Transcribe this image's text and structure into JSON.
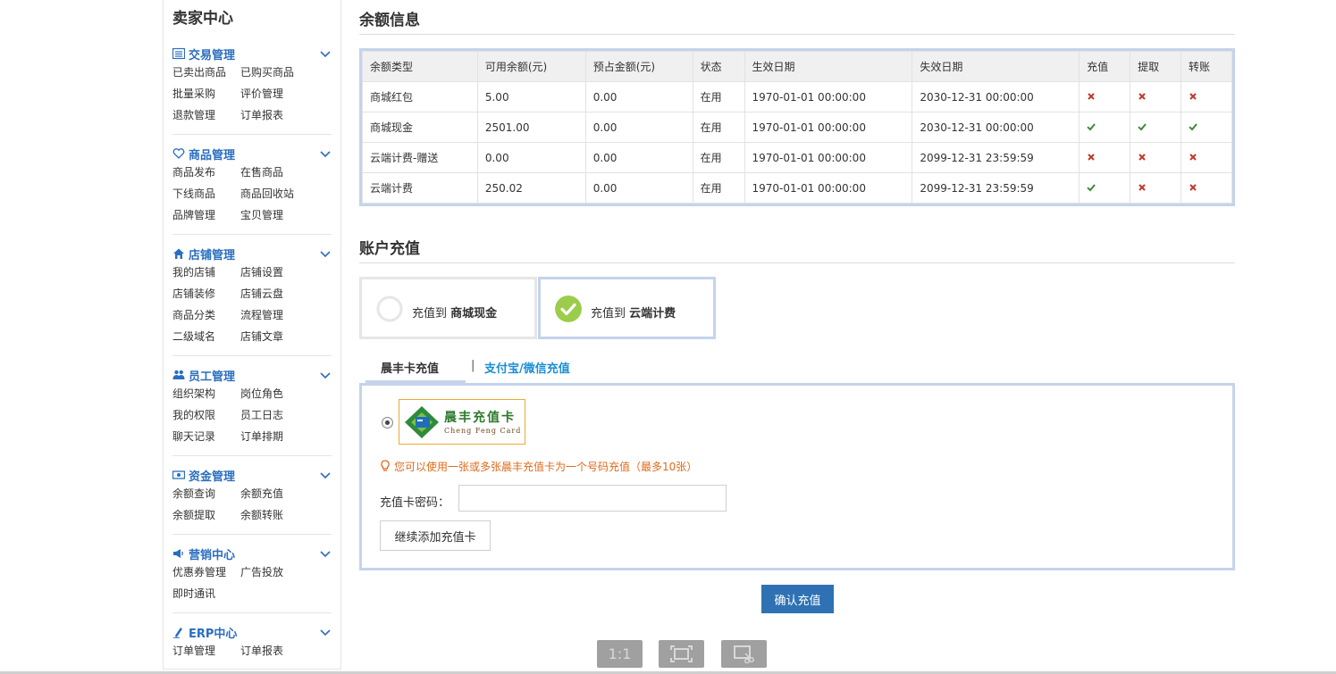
{
  "sidebar": {
    "title": "卖家中心",
    "groups": [
      {
        "title": "交易管理",
        "icon": "list-icon",
        "links": [
          "已卖出商品",
          "已购买商品",
          "批量采购",
          "评价管理",
          "退款管理",
          "订单报表"
        ]
      },
      {
        "title": "商品管理",
        "icon": "heart-icon",
        "links": [
          "商品发布",
          "在售商品",
          "下线商品",
          "商品回收站",
          "品牌管理",
          "宝贝管理"
        ]
      },
      {
        "title": "店铺管理",
        "icon": "home-icon",
        "links": [
          "我的店铺",
          "店铺设置",
          "店铺装修",
          "店铺云盘",
          "商品分类",
          "流程管理",
          "二级域名",
          "店铺文章"
        ]
      },
      {
        "title": "员工管理",
        "icon": "users-icon",
        "links": [
          "组织架构",
          "岗位角色",
          "我的权限",
          "员工日志",
          "聊天记录",
          "订单排期"
        ]
      },
      {
        "title": "资金管理",
        "icon": "money-icon",
        "links": [
          "余额查询",
          "余额充值",
          "余额提取",
          "余额转账"
        ]
      },
      {
        "title": "营销中心",
        "icon": "megaphone-icon",
        "links": [
          "优惠券管理",
          "广告投放",
          "即时通讯"
        ]
      },
      {
        "title": "ERP中心",
        "icon": "pen-icon",
        "links": [
          "订单管理",
          "订单报表"
        ]
      }
    ]
  },
  "balance": {
    "title": "余额信息",
    "columns": [
      "余额类型",
      "可用余额(元)",
      "预占金额(元)",
      "状态",
      "生效日期",
      "失效日期",
      "充值",
      "提取",
      "转账"
    ],
    "rows": [
      {
        "type": "商城红包",
        "available": "5.00",
        "reserved": "0.00",
        "status": "在用",
        "start": "1970-01-01 00:00:00",
        "end": "2030-12-31 00:00:00",
        "recharge": false,
        "withdraw": false,
        "transfer": false
      },
      {
        "type": "商城现金",
        "available": "2501.00",
        "reserved": "0.00",
        "status": "在用",
        "start": "1970-01-01 00:00:00",
        "end": "2030-12-31 00:00:00",
        "recharge": true,
        "withdraw": true,
        "transfer": true
      },
      {
        "type": "云端计费-赠送",
        "available": "0.00",
        "reserved": "0.00",
        "status": "在用",
        "start": "1970-01-01 00:00:00",
        "end": "2099-12-31 23:59:59",
        "recharge": false,
        "withdraw": false,
        "transfer": false
      },
      {
        "type": "云端计费",
        "available": "250.02",
        "reserved": "0.00",
        "status": "在用",
        "start": "1970-01-01 00:00:00",
        "end": "2099-12-31 23:59:59",
        "recharge": true,
        "withdraw": false,
        "transfer": false
      }
    ]
  },
  "recharge": {
    "title": "账户充值",
    "options": [
      {
        "prefix": "充值到 ",
        "target": "商城现金",
        "selected": false
      },
      {
        "prefix": "充值到 ",
        "target": "云端计费",
        "selected": true
      }
    ],
    "tabs": [
      {
        "label": "晨丰卡充值",
        "active": true
      },
      {
        "label": "支付宝/微信充值",
        "active": false
      }
    ],
    "tab_separator": "|",
    "card_logo": {
      "name": "晨丰充值卡",
      "english": "Cheng Feng Card"
    },
    "tip": "您可以使用一张或多张晨丰充值卡为一个号码充值（最多10张）",
    "password_label": "充值卡密码：",
    "password_value": "",
    "add_card_label": "继续添加充值卡",
    "confirm_label": "确认充值"
  },
  "viewer": {
    "buttons": [
      {
        "label": "1:1",
        "icon": "actual-size-icon"
      },
      {
        "label": "",
        "icon": "fit-screen-icon"
      },
      {
        "label": "",
        "icon": "crop-icon"
      }
    ]
  },
  "colors": {
    "accent": "#2a6ebf",
    "link": "#1a8fd6",
    "check": "#3a8a3a",
    "cross": "#c0392b",
    "frame": "#c5d3ec",
    "confirm": "#2f72b4",
    "tip": "#e06a1a"
  }
}
